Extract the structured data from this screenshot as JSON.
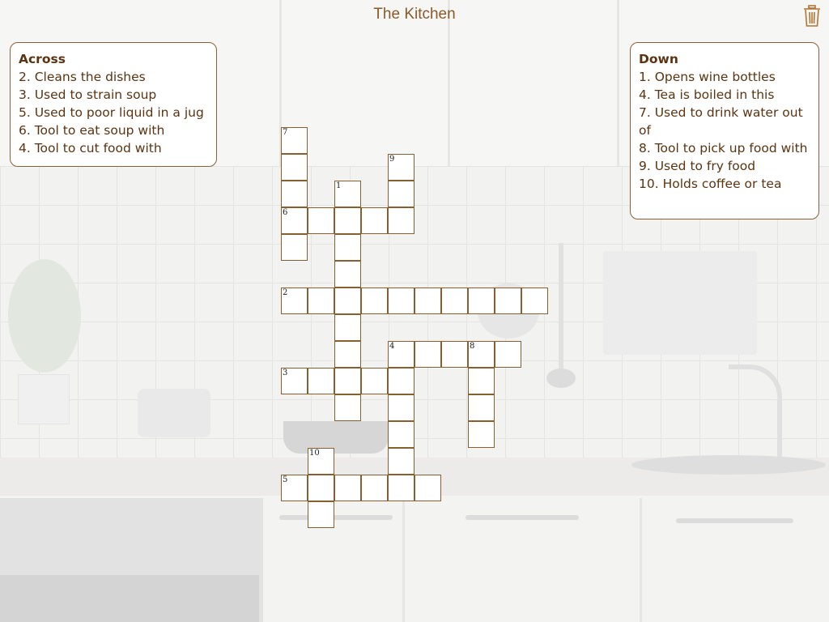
{
  "header": {
    "title": "The Kitchen",
    "trash_icon": "trash-icon"
  },
  "theme": {
    "accent": "#8a5a2b",
    "cell_border": "#86602f",
    "clue_text": "#5a3412"
  },
  "across": {
    "heading": "Across",
    "clues": [
      "2. Cleans the dishes",
      "3. Used to strain soup",
      "5. Used to poor liquid in a jug",
      "6. Tool to eat soup with",
      "4. Tool to cut food with"
    ]
  },
  "down": {
    "heading": "Down",
    "clues": [
      "1. Opens wine bottles",
      "4. Tea is boiled in this",
      "7. Used to drink water out of",
      "8. Tool to pick up food with",
      "9. Used to fry food",
      "10. Holds coffee or tea"
    ]
  },
  "puzzle": {
    "words": [
      {
        "number": "7",
        "direction": "down",
        "row": 0,
        "col": 0,
        "length": 5
      },
      {
        "number": "9",
        "direction": "down",
        "row": 1,
        "col": 4,
        "length": 3
      },
      {
        "number": "1",
        "direction": "down",
        "row": 2,
        "col": 2,
        "length": 9
      },
      {
        "number": "6",
        "direction": "across",
        "row": 3,
        "col": 0,
        "length": 5
      },
      {
        "number": "2",
        "direction": "across",
        "row": 6,
        "col": 0,
        "length": 10
      },
      {
        "number": "4",
        "direction": "across",
        "row": 8,
        "col": 4,
        "length": 5
      },
      {
        "number": "4",
        "direction": "down",
        "row": 8,
        "col": 4,
        "length": 6
      },
      {
        "number": "8",
        "direction": "down",
        "row": 8,
        "col": 7,
        "length": 4
      },
      {
        "number": "3",
        "direction": "across",
        "row": 9,
        "col": 0,
        "length": 5
      },
      {
        "number": "10",
        "direction": "down",
        "row": 12,
        "col": 1,
        "length": 3
      },
      {
        "number": "5",
        "direction": "across",
        "row": 13,
        "col": 0,
        "length": 6
      }
    ]
  }
}
